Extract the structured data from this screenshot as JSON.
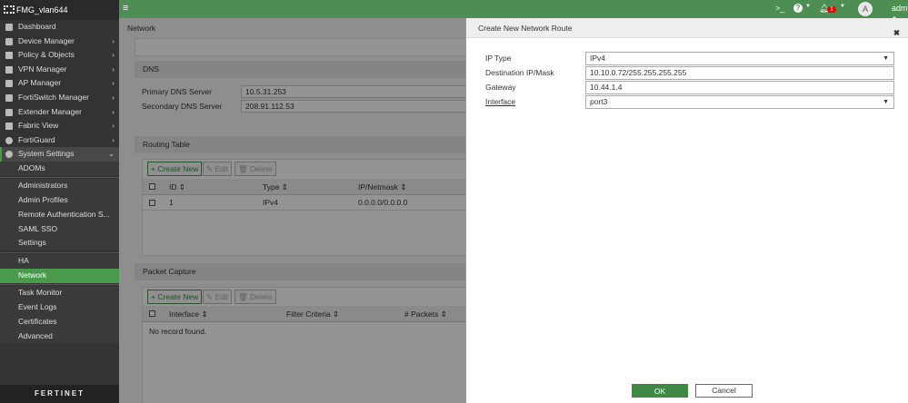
{
  "app": {
    "device_name": "FMG_vlan644",
    "brand": "FERTINET"
  },
  "sidebar": {
    "items": [
      {
        "label": "Dashboard"
      },
      {
        "label": "Device Manager"
      },
      {
        "label": "Policy & Objects"
      },
      {
        "label": "VPN Manager"
      },
      {
        "label": "AP Manager"
      },
      {
        "label": "FortiSwitch Manager"
      },
      {
        "label": "Extender Manager"
      },
      {
        "label": "Fabric View"
      },
      {
        "label": "FortiGuard"
      },
      {
        "label": "System Settings"
      }
    ],
    "sub_items": [
      "ADOMs",
      "Administrators",
      "Admin Profiles",
      "Remote Authentication S...",
      "SAML SSO",
      "Settings",
      "HA",
      "Network",
      "Task Monitor",
      "Event Logs",
      "Certificates",
      "Advanced"
    ]
  },
  "topbar": {
    "notification_count": "1",
    "user": "admin",
    "avatar_letter": "A",
    "cli": ">_",
    "help": "?"
  },
  "main": {
    "breadcrumb": "Network",
    "dns": {
      "title": "DNS",
      "primary_label": "Primary DNS Server",
      "primary_value": "10.5.31.253",
      "secondary_label": "Secondary DNS Server",
      "secondary_value": "208.91.112.53"
    },
    "routing": {
      "title": "Routing Table",
      "create": "Create New",
      "edit": "Edit",
      "delete": "Delete",
      "columns": [
        "ID",
        "Type",
        "IP/Netmask"
      ],
      "rows": [
        [
          "1",
          "IPv4",
          "0.0.0.0/0.0.0.0"
        ]
      ]
    },
    "capture": {
      "title": "Packet Capture",
      "create": "Create New",
      "edit": "Edit",
      "delete": "Delete",
      "columns": [
        "Interface",
        "Filter Criteria",
        "# Packets"
      ],
      "empty": "No record found."
    }
  },
  "panel": {
    "title": "Create New Network Route",
    "fields": [
      {
        "label": "IP Type",
        "value": "IPv4"
      },
      {
        "label": "Destination IP/Mask",
        "value": "10.10.0.72/255.255.255.255"
      },
      {
        "label": "Gateway",
        "value": "10.44.1.4"
      },
      {
        "label": "Interface",
        "value": "port3"
      }
    ],
    "ok": "OK",
    "cancel": "Cancel"
  }
}
